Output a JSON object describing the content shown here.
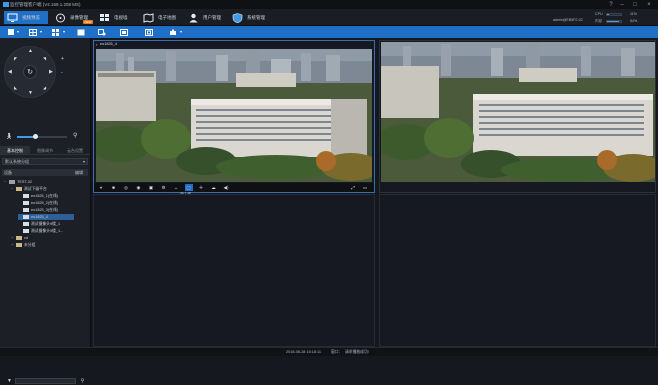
{
  "app": {
    "title": "监控管理客户端 (V4.169.1.208 MS)",
    "window_controls": [
      "?",
      "–",
      "□",
      "×"
    ]
  },
  "nav": {
    "tabs": [
      {
        "label": "视频预览",
        "icon": "monitor-icon",
        "active": true
      },
      {
        "label": "录像管理",
        "icon": "film-reel-icon",
        "badge": "NEW"
      },
      {
        "label": "电视墙",
        "icon": "video-wall-icon"
      },
      {
        "label": "电子地图",
        "icon": "map-icon"
      },
      {
        "label": "用户管理",
        "icon": "user-icon"
      },
      {
        "label": "系统管理",
        "icon": "shield-icon"
      }
    ],
    "user": "admin@EB5F2-02",
    "cpu_label": "CPU",
    "mem_label": "内存",
    "cpu_value": "11%",
    "mem_value": "84%",
    "cpu_level": 0.11,
    "mem_level": 0.84
  },
  "toolbar": {
    "items": [
      "layout-icon",
      "split-screen-icon",
      "grid-icon",
      "fullscreen-icon",
      "record-icon",
      "window-icon",
      "expand-icon",
      "snapshot-icon"
    ]
  },
  "sidebar": {
    "ptz_center": "↻",
    "zoom_in": "+",
    "zoom_out": "-",
    "speed_level": 0.36,
    "tabs": [
      "基本控制",
      "图像调节",
      "云台设置"
    ],
    "group_select": "默认系统分组",
    "list_header": "设备",
    "list_header_right": "编辑",
    "tree": [
      {
        "label": "TEST-02",
        "level": 0,
        "toggle": "−",
        "type": "root"
      },
      {
        "label": "测试下级平台",
        "level": 1,
        "toggle": "−",
        "type": "folder"
      },
      {
        "label": "eo1825_1(在线)",
        "level": 2,
        "toggle": "",
        "type": "camera"
      },
      {
        "label": "eo1825_2(在线)",
        "level": 2,
        "toggle": "",
        "type": "camera"
      },
      {
        "label": "eo1825_3(在线)",
        "level": 2,
        "toggle": "",
        "type": "camera"
      },
      {
        "label": "eo1825_4",
        "level": 2,
        "toggle": "",
        "type": "camera",
        "selected": true
      },
      {
        "label": "测试摄像头9楼_1",
        "level": 2,
        "toggle": "",
        "type": "camera"
      },
      {
        "label": "测试摄像头9楼_1...",
        "level": 2,
        "toggle": "",
        "type": "camera"
      },
      {
        "label": "cd",
        "level": 1,
        "toggle": "+",
        "type": "folder"
      },
      {
        "label": "未分组",
        "level": 1,
        "toggle": "+",
        "type": "folder"
      }
    ],
    "search_placeholder": ""
  },
  "video": {
    "left_camera": "eo1825_4",
    "controls": [
      "⌖",
      "■",
      "◎",
      "◉",
      "▣",
      "⚙",
      "↔",
      "▢",
      "✛",
      "☁",
      "◀)"
    ],
    "tooltip": "一键上墙",
    "right_controls": [
      "⤢",
      "▭"
    ]
  },
  "status": {
    "datetime": "2018-08-28 15:18:11",
    "msg_label": "窗口：",
    "msg": "请求播放成功!"
  }
}
